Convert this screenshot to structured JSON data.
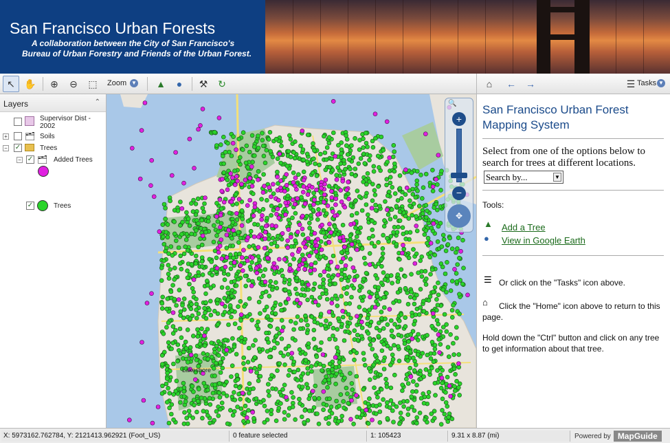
{
  "header": {
    "title": "San Francisco Urban Forests",
    "subtitle_line1": "A collaboration between the City of San Francisco's",
    "subtitle_line2": "Bureau of Urban Forestry and Friends of the Urban Forest."
  },
  "toolbar": {
    "zoom_label": "Zoom",
    "tools": [
      "select-icon",
      "pan-icon",
      "zoom-in-icon",
      "zoom-out-icon",
      "zoom-rect-icon",
      "tree-icon",
      "google-earth-icon",
      "measure-icon",
      "refresh-icon"
    ]
  },
  "taskbar": {
    "tasks_label": "Tasks"
  },
  "layers": {
    "title": "Layers",
    "items": [
      {
        "label": "Supervisor Dist - 2002",
        "checked": false
      },
      {
        "label": "Soils",
        "checked": false
      },
      {
        "label": "Trees",
        "checked": true
      },
      {
        "label": "Added Trees",
        "checked": true
      },
      {
        "label": "Trees",
        "checked": true
      }
    ],
    "colors": {
      "supervisor": "#e8c8e8",
      "added_trees": "#e020e0",
      "trees": "#2ad42a"
    }
  },
  "map": {
    "label_lakeshore": "Lakeshore",
    "water_color": "#a9c8e8",
    "land_color": "#e8e4dc",
    "park_color": "#a8cca0"
  },
  "taskpane": {
    "title": "San Francisco Urban Forest Mapping System",
    "intro": "Select from one of the options below to search for trees at different locations.",
    "search_select": "Search by...",
    "tools_label": "Tools:",
    "add_tree": "Add a Tree",
    "google_earth": "View in Google Earth",
    "tasks_hint": "Or click on the \"Tasks\" icon above.",
    "home_hint": "Click the \"Home\" icon above to return to this page.",
    "ctrl_hint": "Hold down the \"Ctrl\" button and click on any tree to get information about that tree."
  },
  "statusbar": {
    "coords": "X: 5973162.762784, Y: 2121413.962921 (Foot_US)",
    "selection": "0 feature selected",
    "scale": "1: 105423",
    "size": "9.31 x 8.87 (mi)",
    "powered_by": "Powered by",
    "brand": "MapGuide"
  }
}
